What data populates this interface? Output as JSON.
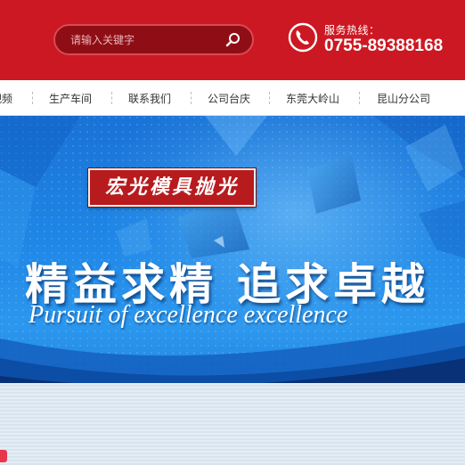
{
  "header": {
    "search": {
      "placeholder": "请输入关键字"
    },
    "hotline_label": "服务热线：",
    "hotline_number": "0755-89388168",
    "icons": {
      "search": "search-icon",
      "phone": "phone-icon"
    },
    "colors": {
      "header_bg": "#cc1822",
      "search_bg": "#8f0e16"
    }
  },
  "nav": {
    "items": [
      {
        "label": "视频"
      },
      {
        "label": "生产车间"
      },
      {
        "label": "联系我们"
      },
      {
        "label": "公司台庆"
      },
      {
        "label": "东莞大岭山"
      },
      {
        "label": "昆山分公司"
      }
    ]
  },
  "banner": {
    "logo_text": "宏光模具抛光",
    "slogan_cn": "精益求精 追求卓越",
    "slogan_en": "Pursuit of excellence excellence",
    "colors": {
      "primary": "#1f86e6",
      "logo_bg": "#b71b1e"
    }
  }
}
